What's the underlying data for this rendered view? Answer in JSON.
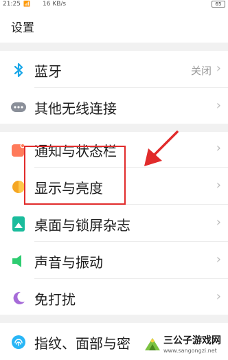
{
  "status_bar": {
    "time": "21:25",
    "speed": "16 KB/s",
    "battery": "65"
  },
  "page_title": "设置",
  "rows": [
    {
      "label": "蓝牙",
      "value": "关闭",
      "icon": "bluetooth-icon",
      "color": "#1aa7e8"
    },
    {
      "label": "其他无线连接",
      "icon": "more-dots-icon",
      "color": "#8a8f99"
    },
    {
      "label": "通知与状态栏",
      "icon": "notification-icon",
      "color": "#ff7a5a"
    },
    {
      "label": "显示与亮度",
      "icon": "display-icon",
      "color": "#f5a623"
    },
    {
      "label": "桌面与锁屏杂志",
      "icon": "desktop-icon",
      "color": "#1abc9c"
    },
    {
      "label": "声音与振动",
      "icon": "sound-icon",
      "color": "#2ecc71"
    },
    {
      "label": "免打扰",
      "icon": "moon-icon",
      "color": "#a66bd8"
    },
    {
      "label": "指纹、面部与密",
      "icon": "fingerprint-icon",
      "color": "#29b6f6"
    }
  ],
  "chevron": "›",
  "annotation_color": "#e12b2b",
  "watermark": {
    "title": "三公子游戏网",
    "url": "www.sangongzi.net"
  }
}
